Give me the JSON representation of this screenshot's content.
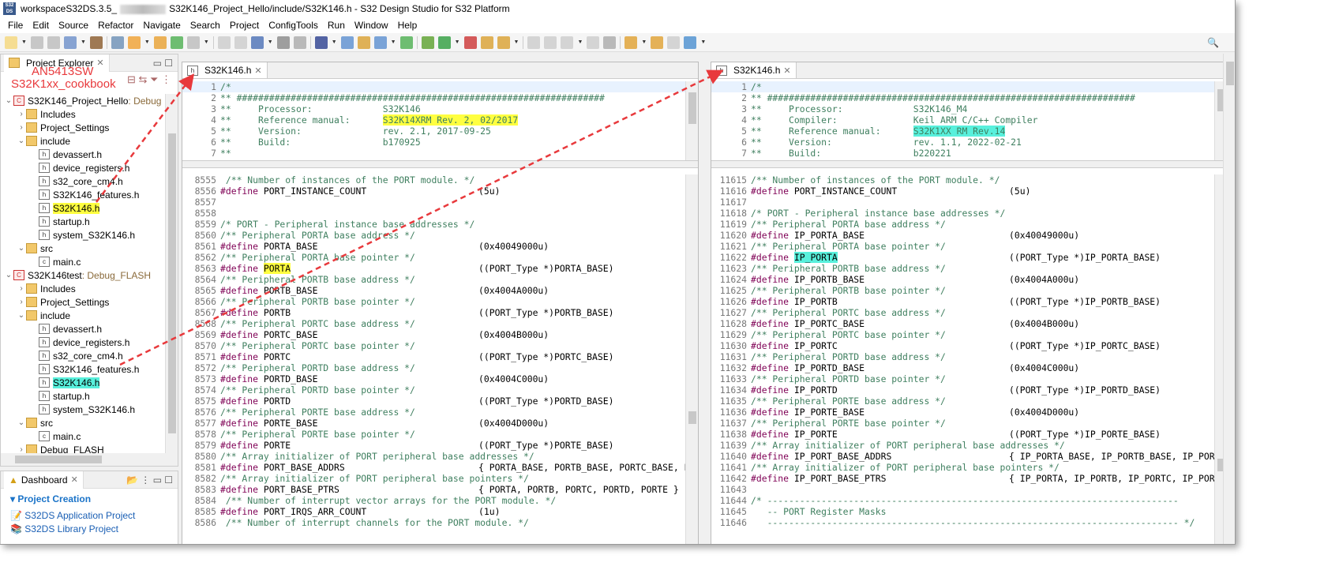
{
  "window": {
    "title_prefix": "workspaceS32DS.3.5_",
    "title_suffix": "S32K146_Project_Hello/include/S32K146.h - S32 Design Studio for S32 Platform",
    "logo": "S32 DS"
  },
  "menu": [
    "File",
    "Edit",
    "Source",
    "Refactor",
    "Navigate",
    "Search",
    "Project",
    "ConfigTools",
    "Run",
    "Window",
    "Help"
  ],
  "explorer": {
    "title": "Project Explorer",
    "annotations": [
      "AN5413SW",
      "S32K1xx_cookbook"
    ],
    "items": [
      {
        "label": "S32K146_Project_Hello",
        "suffix": ": Debug",
        "level": 0,
        "icon": "project",
        "open": true
      },
      {
        "label": "Includes",
        "level": 1,
        "icon": "includes"
      },
      {
        "label": "Project_Settings",
        "level": 1,
        "icon": "folder"
      },
      {
        "label": "include",
        "level": 1,
        "icon": "folder",
        "open": true
      },
      {
        "label": "devassert.h",
        "level": 2,
        "icon": "h"
      },
      {
        "label": "device_registers.h",
        "level": 2,
        "icon": "h"
      },
      {
        "label": "s32_core_cm4.h",
        "level": 2,
        "icon": "h"
      },
      {
        "label": "S32K146_features.h",
        "level": 2,
        "icon": "h"
      },
      {
        "label": "S32K146.h",
        "level": 2,
        "icon": "h",
        "hl": "yellow"
      },
      {
        "label": "startup.h",
        "level": 2,
        "icon": "h"
      },
      {
        "label": "system_S32K146.h",
        "level": 2,
        "icon": "h"
      },
      {
        "label": "src",
        "level": 1,
        "icon": "src",
        "open": true
      },
      {
        "label": "main.c",
        "level": 2,
        "icon": "c"
      },
      {
        "label": "S32K146test",
        "suffix": ": Debug_FLASH",
        "level": 0,
        "icon": "project",
        "open": true
      },
      {
        "label": "Includes",
        "level": 1,
        "icon": "includes"
      },
      {
        "label": "Project_Settings",
        "level": 1,
        "icon": "folder"
      },
      {
        "label": "include",
        "level": 1,
        "icon": "folder",
        "open": true
      },
      {
        "label": "devassert.h",
        "level": 2,
        "icon": "h"
      },
      {
        "label": "device_registers.h",
        "level": 2,
        "icon": "h"
      },
      {
        "label": "s32_core_cm4.h",
        "level": 2,
        "icon": "h"
      },
      {
        "label": "S32K146_features.h",
        "level": 2,
        "icon": "h"
      },
      {
        "label": "S32K146.h",
        "level": 2,
        "icon": "h",
        "hl": "cyan"
      },
      {
        "label": "startup.h",
        "level": 2,
        "icon": "h"
      },
      {
        "label": "system_S32K146.h",
        "level": 2,
        "icon": "h"
      },
      {
        "label": "src",
        "level": 1,
        "icon": "src",
        "open": true
      },
      {
        "label": "main.c",
        "level": 2,
        "icon": "c"
      },
      {
        "label": "Debug_FLASH",
        "level": 1,
        "icon": "folder"
      }
    ]
  },
  "dashboard": {
    "title": "Dashboard",
    "section": "Project Creation",
    "links": [
      "S32DS Application Project",
      "S32DS Library Project"
    ]
  },
  "editors": [
    {
      "tab": "S32K146.h",
      "top": [
        {
          "n": "1",
          "k": "c",
          "t": "/*"
        },
        {
          "n": "2",
          "k": "c",
          "t": "** ####################################################################"
        },
        {
          "n": "3",
          "k": "c",
          "t": "**     Processor:             S32K146"
        },
        {
          "n": "4",
          "k": "c",
          "t": "**     Reference manual:      ",
          "hl": "S32K14XRM Rev. 2, 02/2017",
          "hc": "yellow"
        },
        {
          "n": "5",
          "k": "c",
          "t": "**     Version:               rev. 2.1, 2017-09-25"
        },
        {
          "n": "6",
          "k": "c",
          "t": "**     Build:                 b170925"
        },
        {
          "n": "7",
          "k": "c",
          "t": "**"
        }
      ],
      "bottom": [
        {
          "n": "8555",
          "k": "c",
          "t": " /** Number of instances of the PORT module. */"
        },
        {
          "n": "8556",
          "k": "d",
          "name": "PORT_INSTANCE_COUNT",
          "val": "(5u)"
        },
        {
          "n": "8557",
          "k": "c",
          "t": ""
        },
        {
          "n": "8558",
          "k": "c",
          "t": ""
        },
        {
          "n": "8559",
          "k": "c",
          "t": "/* PORT - Peripheral instance base addresses */"
        },
        {
          "n": "8560",
          "k": "c",
          "t": "/** Peripheral PORTA base address */"
        },
        {
          "n": "8561",
          "k": "d",
          "name": "PORTA_BASE",
          "val": "(0x40049000u)"
        },
        {
          "n": "8562",
          "k": "c",
          "t": "/** Peripheral PORTA base pointer */"
        },
        {
          "n": "8563",
          "k": "d",
          "name": "PORTA",
          "val": "((PORT_Type *)PORTA_BASE)",
          "hc": "yellow"
        },
        {
          "n": "8564",
          "k": "c",
          "t": "/** Peripheral PORTB base address */"
        },
        {
          "n": "8565",
          "k": "d",
          "name": "PORTB_BASE",
          "val": "(0x4004A000u)"
        },
        {
          "n": "8566",
          "k": "c",
          "t": "/** Peripheral PORTB base pointer */"
        },
        {
          "n": "8567",
          "k": "d",
          "name": "PORTB",
          "val": "((PORT_Type *)PORTB_BASE)"
        },
        {
          "n": "8568",
          "k": "c",
          "t": "/** Peripheral PORTC base address */"
        },
        {
          "n": "8569",
          "k": "d",
          "name": "PORTC_BASE",
          "val": "(0x4004B000u)"
        },
        {
          "n": "8570",
          "k": "c",
          "t": "/** Peripheral PORTC base pointer */"
        },
        {
          "n": "8571",
          "k": "d",
          "name": "PORTC",
          "val": "((PORT_Type *)PORTC_BASE)"
        },
        {
          "n": "8572",
          "k": "c",
          "t": "/** Peripheral PORTD base address */"
        },
        {
          "n": "8573",
          "k": "d",
          "name": "PORTD_BASE",
          "val": "(0x4004C000u)"
        },
        {
          "n": "8574",
          "k": "c",
          "t": "/** Peripheral PORTD base pointer */"
        },
        {
          "n": "8575",
          "k": "d",
          "name": "PORTD",
          "val": "((PORT_Type *)PORTD_BASE)"
        },
        {
          "n": "8576",
          "k": "c",
          "t": "/** Peripheral PORTE base address */"
        },
        {
          "n": "8577",
          "k": "d",
          "name": "PORTE_BASE",
          "val": "(0x4004D000u)"
        },
        {
          "n": "8578",
          "k": "c",
          "t": "/** Peripheral PORTE base pointer */"
        },
        {
          "n": "8579",
          "k": "d",
          "name": "PORTE",
          "val": "((PORT_Type *)PORTE_BASE)"
        },
        {
          "n": "8580",
          "k": "c",
          "t": "/** Array initializer of PORT peripheral base addresses */"
        },
        {
          "n": "8581",
          "k": "d",
          "name": "PORT_BASE_ADDRS",
          "val": "{ PORTA_BASE, PORTB_BASE, PORTC_BASE, PC"
        },
        {
          "n": "8582",
          "k": "c",
          "t": "/** Array initializer of PORT peripheral base pointers */"
        },
        {
          "n": "8583",
          "k": "d",
          "name": "PORT_BASE_PTRS",
          "val": "{ PORTA, PORTB, PORTC, PORTD, PORTE }"
        },
        {
          "n": "8584",
          "k": "c",
          "t": " /** Number of interrupt vector arrays for the PORT module. */"
        },
        {
          "n": "8585",
          "k": "d",
          "name": "PORT_IRQS_ARR_COUNT",
          "val": "(1u)"
        },
        {
          "n": "8586",
          "k": "c",
          "t": " /** Number of interrupt channels for the PORT module. */"
        }
      ]
    },
    {
      "tab": "S32K146.h",
      "top": [
        {
          "n": "1",
          "k": "c",
          "t": "/*"
        },
        {
          "n": "2",
          "k": "c",
          "t": "** ####################################################################"
        },
        {
          "n": "3",
          "k": "c",
          "t": "**     Processor:             S32K146_M4"
        },
        {
          "n": "4",
          "k": "c",
          "t": "**     Compiler:              Keil ARM C/C++ Compiler"
        },
        {
          "n": "5",
          "k": "c",
          "t": "**     Reference manual:      ",
          "hl": "S32K1XX RM Rev.14",
          "hc": "cyan"
        },
        {
          "n": "6",
          "k": "c",
          "t": "**     Version:               rev. 1.1, 2022-02-21"
        },
        {
          "n": "7",
          "k": "c",
          "t": "**     Build:                 b220221"
        }
      ],
      "bottom": [
        {
          "n": "11615",
          "k": "c",
          "t": "/** Number of instances of the PORT module. */"
        },
        {
          "n": "11616",
          "k": "d",
          "name": "PORT_INSTANCE_COUNT",
          "val": "(5u)"
        },
        {
          "n": "11617",
          "k": "c",
          "t": ""
        },
        {
          "n": "11618",
          "k": "c",
          "t": "/* PORT - Peripheral instance base addresses */"
        },
        {
          "n": "11619",
          "k": "c",
          "t": "/** Peripheral PORTA base address */"
        },
        {
          "n": "11620",
          "k": "d",
          "name": "IP_PORTA_BASE",
          "val": "(0x40049000u)"
        },
        {
          "n": "11621",
          "k": "c",
          "t": "/** Peripheral PORTA base pointer */"
        },
        {
          "n": "11622",
          "k": "d",
          "name": "IP_PORTA",
          "val": "((PORT_Type *)IP_PORTA_BASE)",
          "hc": "cyan"
        },
        {
          "n": "11623",
          "k": "c",
          "t": "/** Peripheral PORTB base address */"
        },
        {
          "n": "11624",
          "k": "d",
          "name": "IP_PORTB_BASE",
          "val": "(0x4004A000u)"
        },
        {
          "n": "11625",
          "k": "c",
          "t": "/** Peripheral PORTB base pointer */"
        },
        {
          "n": "11626",
          "k": "d",
          "name": "IP_PORTB",
          "val": "((PORT_Type *)IP_PORTB_BASE)"
        },
        {
          "n": "11627",
          "k": "c",
          "t": "/** Peripheral PORTC base address */"
        },
        {
          "n": "11628",
          "k": "d",
          "name": "IP_PORTC_BASE",
          "val": "(0x4004B000u)"
        },
        {
          "n": "11629",
          "k": "c",
          "t": "/** Peripheral PORTC base pointer */"
        },
        {
          "n": "11630",
          "k": "d",
          "name": "IP_PORTC",
          "val": "((PORT_Type *)IP_PORTC_BASE)"
        },
        {
          "n": "11631",
          "k": "c",
          "t": "/** Peripheral PORTD base address */"
        },
        {
          "n": "11632",
          "k": "d",
          "name": "IP_PORTD_BASE",
          "val": "(0x4004C000u)"
        },
        {
          "n": "11633",
          "k": "c",
          "t": "/** Peripheral PORTD base pointer */"
        },
        {
          "n": "11634",
          "k": "d",
          "name": "IP_PORTD",
          "val": "((PORT_Type *)IP_PORTD_BASE)"
        },
        {
          "n": "11635",
          "k": "c",
          "t": "/** Peripheral PORTE base address */"
        },
        {
          "n": "11636",
          "k": "d",
          "name": "IP_PORTE_BASE",
          "val": "(0x4004D000u)"
        },
        {
          "n": "11637",
          "k": "c",
          "t": "/** Peripheral PORTE base pointer */"
        },
        {
          "n": "11638",
          "k": "d",
          "name": "IP_PORTE",
          "val": "((PORT_Type *)IP_PORTE_BASE)"
        },
        {
          "n": "11639",
          "k": "c",
          "t": "/** Array initializer of PORT peripheral base addresses */"
        },
        {
          "n": "11640",
          "k": "d",
          "name": "IP_PORT_BASE_ADDRS",
          "val": "{ IP_PORTA_BASE, IP_PORTB_BASE, IP_PORTC"
        },
        {
          "n": "11641",
          "k": "c",
          "t": "/** Array initializer of PORT peripheral base pointers */"
        },
        {
          "n": "11642",
          "k": "d",
          "name": "IP_PORT_BASE_PTRS",
          "val": "{ IP_PORTA, IP_PORTB, IP_PORTC, IP_PORTD"
        },
        {
          "n": "11643",
          "k": "c",
          "t": ""
        },
        {
          "n": "11644",
          "k": "c",
          "t": "/* ----------------------------------------------------------------------------"
        },
        {
          "n": "11645",
          "k": "c",
          "t": "   -- PORT Register Masks"
        },
        {
          "n": "11646",
          "k": "c",
          "t": "   ---------------------------------------------------------------------------- */"
        }
      ]
    }
  ],
  "keyword": "#define",
  "colors": {
    "yellow": "#ffff40",
    "cyan": "#58f0dc",
    "annotation": "#e8393c"
  }
}
